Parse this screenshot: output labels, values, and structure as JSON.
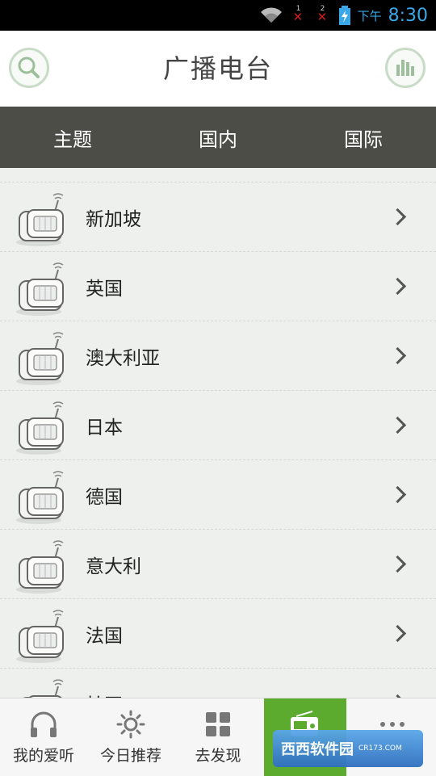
{
  "status_bar": {
    "ampm": "下午",
    "time": "8:30",
    "sim1": "1",
    "sim2": "2"
  },
  "app_bar": {
    "title": "广播电台"
  },
  "tabs": [
    {
      "label": "主题"
    },
    {
      "label": "国内"
    },
    {
      "label": "国际",
      "selected": true
    }
  ],
  "stations": [
    {
      "label": "新加坡"
    },
    {
      "label": "英国"
    },
    {
      "label": "澳大利亚"
    },
    {
      "label": "日本"
    },
    {
      "label": "德国"
    },
    {
      "label": "意大利"
    },
    {
      "label": "法国"
    },
    {
      "label": "韩国"
    }
  ],
  "bottom_nav": [
    {
      "label": "我的爱听",
      "icon": "headphones-icon"
    },
    {
      "label": "今日推荐",
      "icon": "sun-icon"
    },
    {
      "label": "去发现",
      "icon": "grid-icon"
    },
    {
      "label": "",
      "icon": "radio-icon",
      "active": true
    },
    {
      "label": "",
      "icon": "more-icon"
    }
  ],
  "watermark": {
    "brand": "西西软件园",
    "url": "CR173.COM"
  },
  "colors": {
    "accent_green": "#3cb43a",
    "tab_bg": "#4d4d47",
    "status_blue": "#39a7e8"
  }
}
